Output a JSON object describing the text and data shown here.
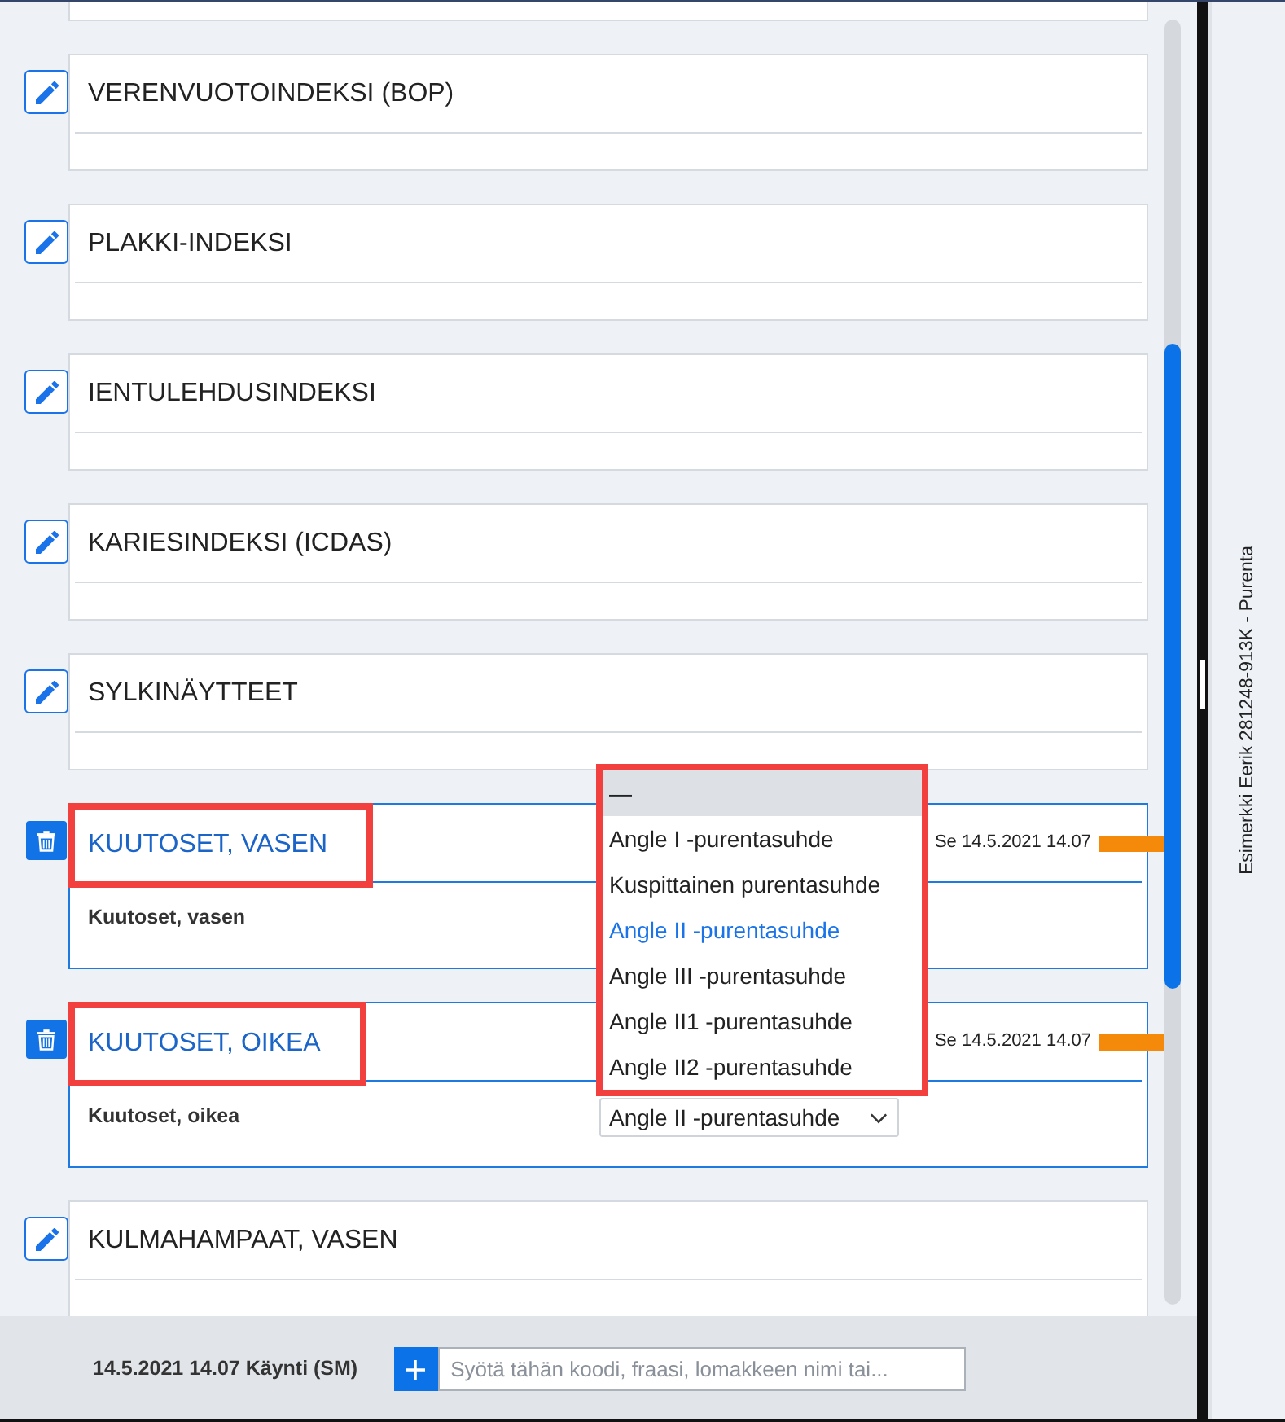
{
  "cards": [
    {
      "kind": "collapsed",
      "title": "VERENVUOTOINDEKSI (BOP)",
      "annotated": false
    },
    {
      "kind": "collapsed",
      "title": "PLAKKI-INDEKSI",
      "annotated": false
    },
    {
      "kind": "collapsed",
      "title": "IENTULEHDUSINDEKSI",
      "annotated": false
    },
    {
      "kind": "collapsed",
      "title": "KARIESINDEKSI (ICDAS)",
      "annotated": false
    },
    {
      "kind": "collapsed",
      "title": "SYLKINÄYTTEET",
      "annotated": false
    },
    {
      "kind": "expanded",
      "title": "KUUTOSET, VASEN",
      "annotated": true,
      "timestamp": "Se 14.5.2021 14.07",
      "subtitle": "Kuutoset, vasen"
    },
    {
      "kind": "expanded",
      "title": "KUUTOSET, OIKEA",
      "annotated": true,
      "timestamp": "Se 14.5.2021 14.07",
      "subtitle": "Kuutoset, oikea",
      "select": {
        "value": "Angle II -purentasuhde",
        "expanded": true,
        "annotated": true,
        "options": [
          {
            "label": "—",
            "selected": false,
            "hovered": true
          },
          {
            "label": "Angle I -purentasuhde",
            "selected": false,
            "hovered": false
          },
          {
            "label": "Kuspittainen purentasuhde",
            "selected": false,
            "hovered": false
          },
          {
            "label": "Angle II -purentasuhde",
            "selected": true,
            "hovered": false
          },
          {
            "label": "Angle III -purentasuhde",
            "selected": false,
            "hovered": false
          },
          {
            "label": "Angle II1 -purentasuhde",
            "selected": false,
            "hovered": false
          },
          {
            "label": "Angle II2 -purentasuhde",
            "selected": false,
            "hovered": false
          }
        ]
      }
    },
    {
      "kind": "collapsed",
      "title": "KULMAHAMPAAT, VASEN",
      "annotated": false
    }
  ],
  "side_panel": {
    "title": "Esimerkki Eerik 281248-913K - Purenta"
  },
  "footer": {
    "visit": "14.5.2021 14.07 Käynti (SM)",
    "search": {
      "placeholder": "Syötä tähän koodi, fraasi, lomakkeen nimi tai..."
    }
  }
}
